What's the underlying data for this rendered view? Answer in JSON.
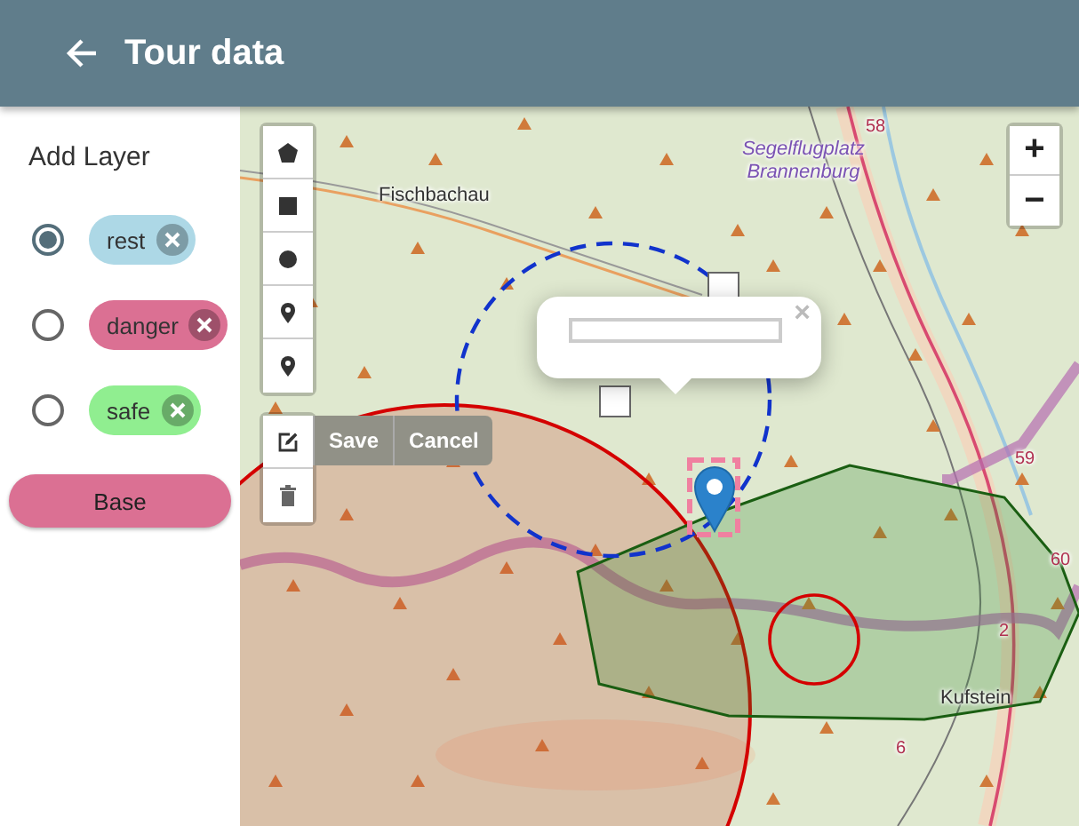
{
  "header": {
    "title": "Tour data"
  },
  "sidebar": {
    "heading": "Add Layer",
    "layers": [
      {
        "name": "rest",
        "selected": true,
        "color": "#add8e6"
      },
      {
        "name": "danger",
        "selected": false,
        "color": "#db7093"
      },
      {
        "name": "safe",
        "selected": false,
        "color": "#90ee90"
      }
    ],
    "base_button": "Base"
  },
  "map": {
    "labels": [
      {
        "kind": "place",
        "text": "Fischbachau"
      },
      {
        "kind": "airfield",
        "text": "Segelflugplatz Brannenburg"
      },
      {
        "kind": "road",
        "text": "58"
      },
      {
        "kind": "road",
        "text": "59"
      },
      {
        "kind": "road",
        "text": "60"
      },
      {
        "kind": "road",
        "text": "2"
      },
      {
        "kind": "road",
        "text": "6"
      },
      {
        "kind": "place",
        "text": "Kufstein"
      }
    ],
    "zoom_buttons": [
      "+",
      "−"
    ],
    "draw_tools": [
      {
        "kind": "polygon"
      },
      {
        "kind": "rectangle"
      },
      {
        "kind": "circle"
      },
      {
        "kind": "marker"
      },
      {
        "kind": "marker"
      }
    ],
    "edit_tools": [
      {
        "kind": "edit"
      },
      {
        "kind": "delete"
      }
    ],
    "edit_actions": [
      "Save",
      "Cancel"
    ],
    "popup": {
      "close": "×"
    }
  }
}
